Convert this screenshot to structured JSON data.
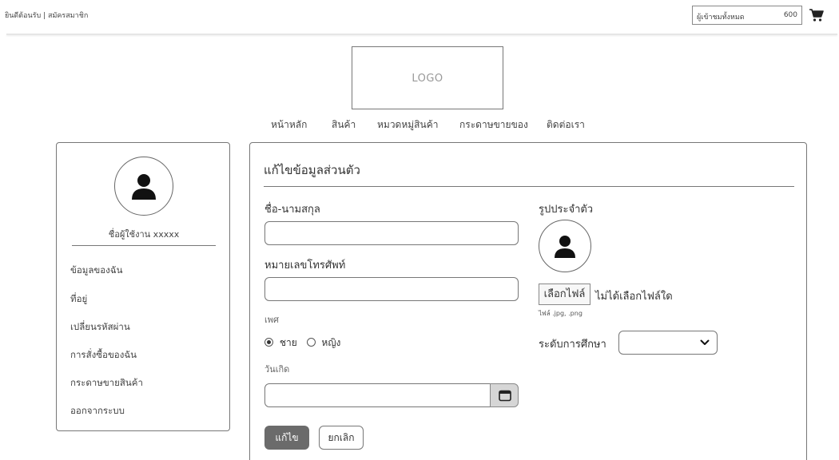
{
  "header": {
    "welcome": "ยินดีต้อนรับ | สมัครสมาชิก",
    "visitor_label": "ผู้เข้าชมทั้งหมด",
    "visitor_count": "600",
    "cart_icon": "cart-icon"
  },
  "logo": {
    "text": "LOGO"
  },
  "nav": {
    "items": [
      "หน้าหลัก",
      "สินค้า",
      "หมวดหมู่สินค้า",
      "กระดาษขายของ",
      "ติดต่อเรา"
    ]
  },
  "sidebar": {
    "avatar_icon": "user-icon",
    "username": "ชื่อผู้ใช้งาน xxxxx",
    "items": [
      "ข้อมูลของฉัน",
      "ที่อยู่",
      "เปลี่ยนรหัสผ่าน",
      "การสั่งซื้อของฉัน",
      "กระดาษขายสินค้า",
      "ออกจากระบบ"
    ]
  },
  "form": {
    "title": "แก้ไขข้อมูลส่วนตัว",
    "name_label": "ชื่อ-นามสกุล",
    "name_value": "",
    "phone_label": "หมายเลขโทรศัพท์",
    "phone_value": "",
    "gender_label": "เพศ",
    "gender_options": [
      "ชาย",
      "หญิง"
    ],
    "gender_selected": "ชาย",
    "birthday_label": "วันเกิด",
    "birthday_value": "",
    "calendar_icon": "calendar-icon",
    "photo_label": "รูปประจำตัว",
    "photo_icon": "user-icon",
    "file_button": "เลือกไฟล์",
    "file_status": "ไม่ได้เลือกไฟล์ใด",
    "file_hint": "ไฟล์ .jpg, .png",
    "education_label": "ระดับการศึกษา",
    "education_value": "",
    "save_button": "แก้ไข",
    "cancel_button": "ยกเลิก"
  },
  "colors": {
    "border": "#777777",
    "save_bg": "#6b6b6b",
    "calendar_bg": "#d6d6d6"
  }
}
